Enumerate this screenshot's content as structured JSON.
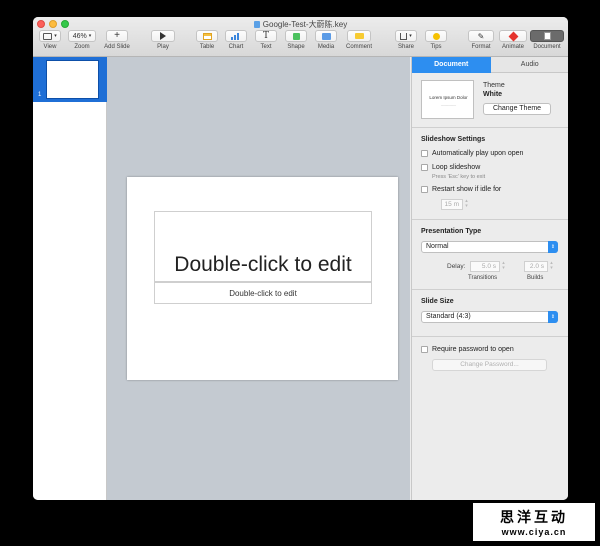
{
  "window": {
    "title": "Google-Test-大蔚陈.key"
  },
  "toolbar": {
    "view": "View",
    "zoom_value": "46%",
    "zoom": "Zoom",
    "add_slide": "Add Slide",
    "play": "Play",
    "table": "Table",
    "chart": "Chart",
    "text": "Text",
    "text_glyph": "T",
    "shape": "Shape",
    "media": "Media",
    "comment": "Comment",
    "share": "Share",
    "tips": "Tips",
    "format": "Format",
    "animate": "Animate",
    "document": "Document"
  },
  "navigator": {
    "slides": [
      {
        "number": "1"
      }
    ]
  },
  "slide": {
    "title": "Double-click to edit",
    "subtitle": "Double-click to edit"
  },
  "inspector": {
    "tabs": [
      "Document",
      "Audio"
    ],
    "theme_label": "Theme",
    "theme_name": "White",
    "theme_preview_title": "Lorem Ipsum Dolor",
    "change_theme": "Change Theme",
    "slideshow_settings": {
      "title": "Slideshow Settings",
      "autoplay": "Automatically play upon open",
      "loop": "Loop slideshow",
      "loop_hint": "Press 'Esc' key to exit",
      "restart": "Restart show if idle for",
      "idle_value": "15 m"
    },
    "presentation_type": {
      "title": "Presentation Type",
      "selected": "Normal",
      "delay_label": "Delay:",
      "transitions_value": "5.0 s",
      "builds_value": "2.0 s",
      "transitions_label": "Transitions",
      "builds_label": "Builds"
    },
    "slide_size": {
      "title": "Slide Size",
      "selected": "Standard (4:3)"
    },
    "password": {
      "require": "Require password to open",
      "change": "Change Password..."
    }
  },
  "watermark": {
    "brand": "思洋互动",
    "url": "www.ciya.cn"
  },
  "colors": {
    "accent": "#2d8ef0",
    "selection": "#1f6fd6",
    "canvas": "#c4cad1"
  }
}
